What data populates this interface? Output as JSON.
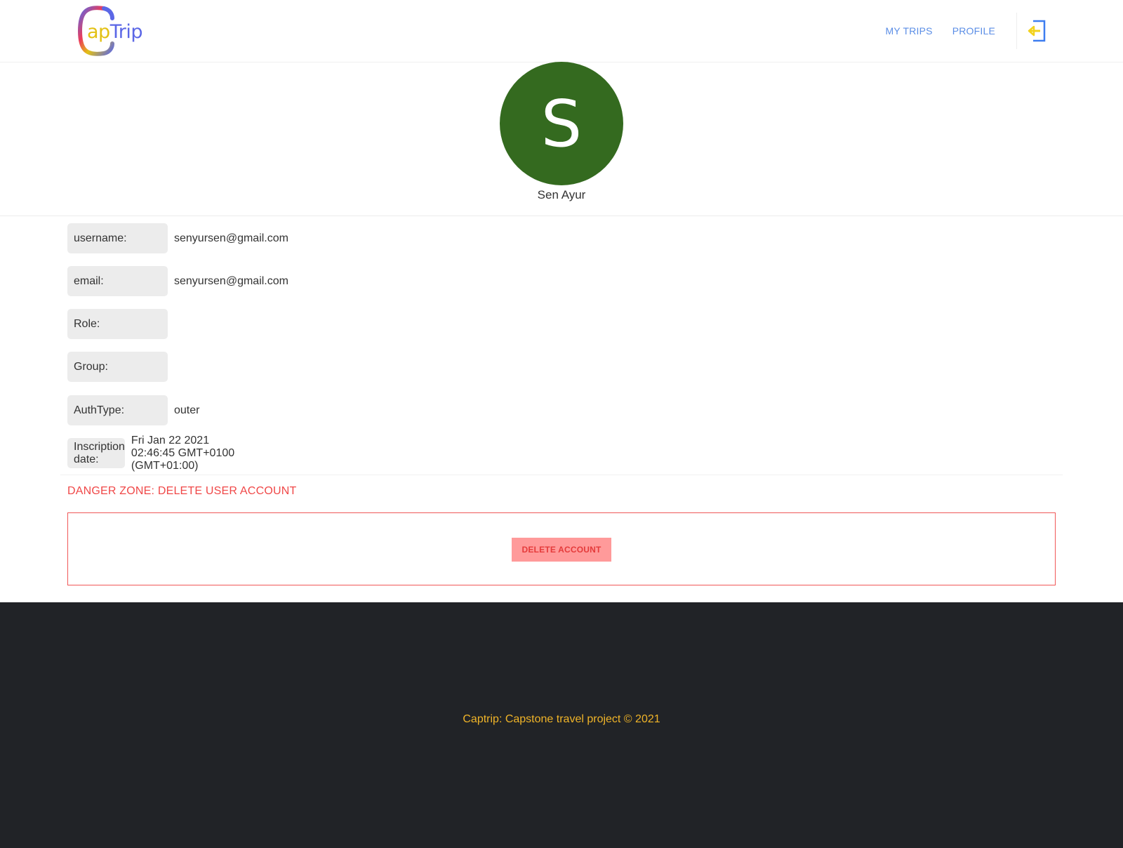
{
  "header": {
    "logo": {
      "part_ap": "ap",
      "part_trip": "Trip",
      "colors": [
        "#e3c114",
        "#ec3c5a",
        "#5b67e6"
      ]
    },
    "nav": [
      {
        "label": "MY TRIPS"
      },
      {
        "label": "PROFILE"
      }
    ],
    "logout_icon": "logout-arrow-icon"
  },
  "profile": {
    "avatar_letter": "S",
    "avatar_color": "#346a1f",
    "display_name": "Sen Ayur"
  },
  "fields": {
    "username": {
      "label": "username:",
      "value": "senyursen@gmail.com"
    },
    "email": {
      "label": "email:",
      "value": "senyursen@gmail.com"
    },
    "role": {
      "label": "Role:",
      "value": ""
    },
    "group": {
      "label": "Group:",
      "value": ""
    },
    "authtype": {
      "label": "AuthType:",
      "value": "outer"
    },
    "inscription": {
      "label": "Inscription date:",
      "value": "Fri Jan 22 2021 02:46:45 GMT+0100 (GMT+01:00)"
    }
  },
  "danger_zone": {
    "title": "DANGER ZONE: DELETE USER ACCOUNT",
    "button_label": "DELETE ACCOUNT",
    "accent_color": "#f04848"
  },
  "footer": {
    "text": "Captrip: Capstone travel project © 2021"
  }
}
